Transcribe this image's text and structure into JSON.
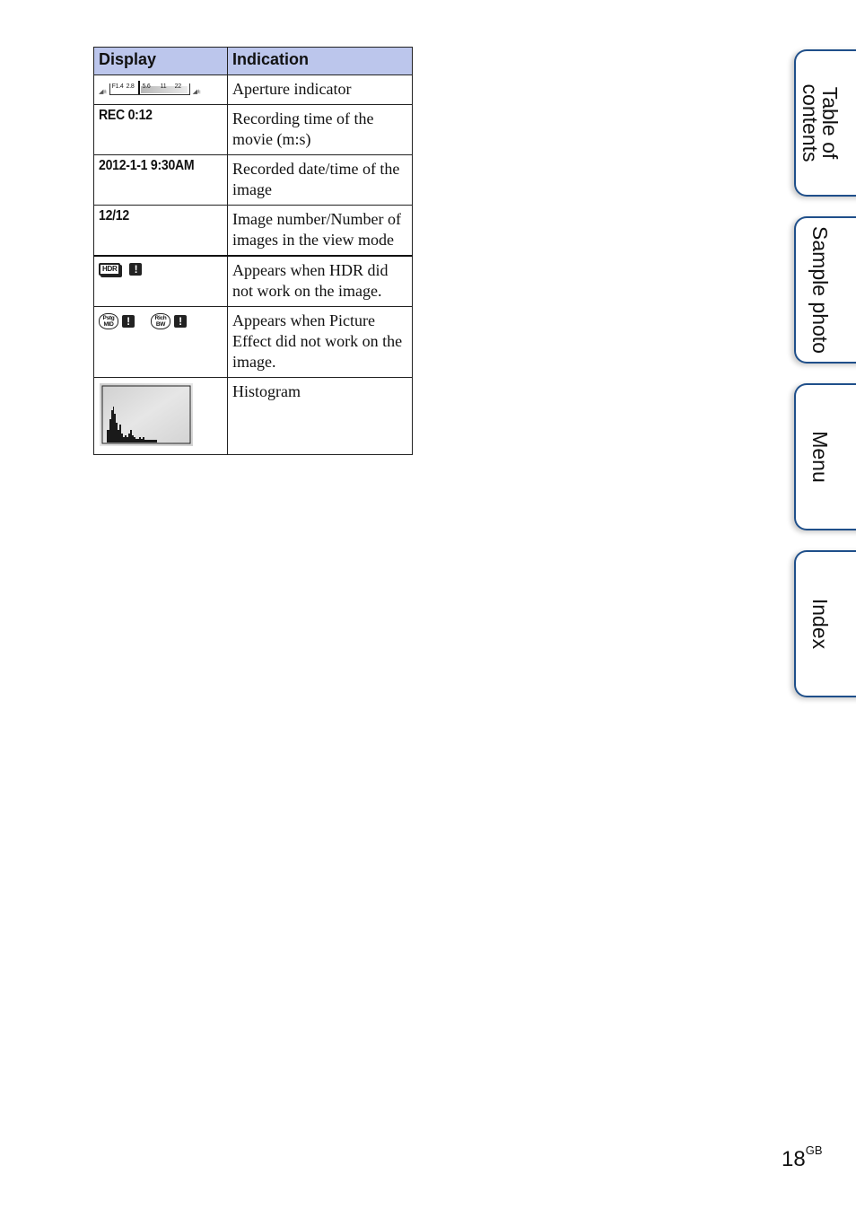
{
  "table": {
    "headers": {
      "display": "Display",
      "indication": "Indication"
    },
    "header_color": "#bcc6ec",
    "rows": [
      {
        "display_type": "aperture-scale",
        "display": "F1.4 2.8 5.6 11 22",
        "aperture_marks": [
          "F1.4",
          "2.8",
          "5.6",
          "11",
          "22"
        ],
        "indication": "Aperture indicator"
      },
      {
        "display_type": "text",
        "display": "REC 0:12",
        "indication": "Recording time of the movie (m:s)"
      },
      {
        "display_type": "text",
        "display": "2012-1-1 9:30AM",
        "indication": "Recorded date/time of the image"
      },
      {
        "display_type": "text",
        "display": "12/12",
        "indication": "Image number/Number of images in the view mode"
      },
      {
        "display_type": "icons",
        "icons": [
          "hdr-icon",
          "warning-icon"
        ],
        "hdr_label": "HDR",
        "warn_label": "!",
        "indication": "Appears when HDR did not work on the image."
      },
      {
        "display_type": "icons",
        "icons": [
          "posterization-mid-icon",
          "warning-icon",
          "rich-tone-bw-icon",
          "warning-icon"
        ],
        "pe1_line1": "Pstg",
        "pe1_line2": "MID",
        "pe2_line1": "Rich",
        "pe2_line2": "BW",
        "warn_label": "!",
        "indication": "Appears when Picture Effect did not work on the image."
      },
      {
        "display_type": "histogram",
        "indication": "Histogram"
      }
    ]
  },
  "side_tabs": [
    {
      "label_line1": "Table of",
      "label_line2": "contents"
    },
    {
      "label": "Sample photo"
    },
    {
      "label": "Menu"
    },
    {
      "label": "Index"
    }
  ],
  "tab_border_color": "#1f4f8a",
  "page_number": {
    "number": "18",
    "suffix": "GB"
  }
}
